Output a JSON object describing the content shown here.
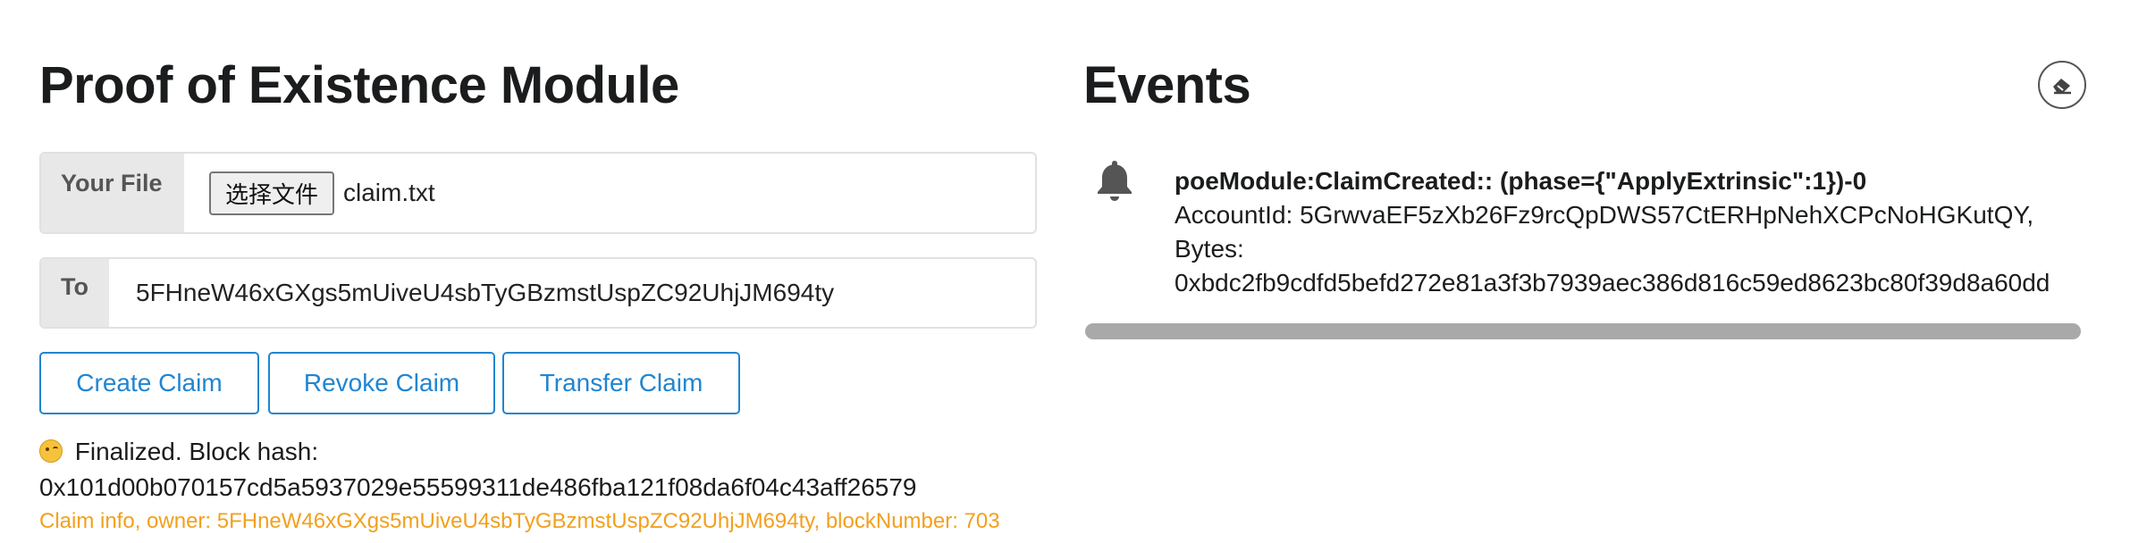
{
  "poe": {
    "title": "Proof of Existence Module",
    "file_label": "Your File",
    "file_button": "选择文件",
    "file_name": "claim.txt",
    "to_label": "To",
    "to_value": "5FHneW46xGXgs5mUiveU4sbTyGBzmstUspZC92UhjJM694ty",
    "buttons": {
      "create": "Create Claim",
      "revoke": "Revoke Claim",
      "transfer": "Transfer Claim"
    },
    "status": {
      "line1": "Finalized. Block hash:",
      "line2": "0x101d00b070157cd5a5937029e55599311de486fba121f08da6f04c43aff26579"
    },
    "claim_info": "Claim info, owner: 5FHneW46xGXgs5mUiveU4sbTyGBzmstUspZC92UhjJM694ty, blockNumber: 703"
  },
  "events": {
    "title": "Events",
    "clear_icon": "eraser-icon",
    "items": [
      {
        "icon": "bell-icon",
        "title": "poeModule:ClaimCreated:: (phase={\"ApplyExtrinsic\":1})-0",
        "line1": "AccountId: 5GrwvaEF5zXb26Fz9rcQpDWS57CtERHpNehXCPcNoHGKutQY,",
        "line2": "Bytes:",
        "line3": "0xbdc2fb9cdfd5befd272e81a3f3b7939aec386d816c59ed8623bc80f39d8a60dd"
      }
    ]
  }
}
